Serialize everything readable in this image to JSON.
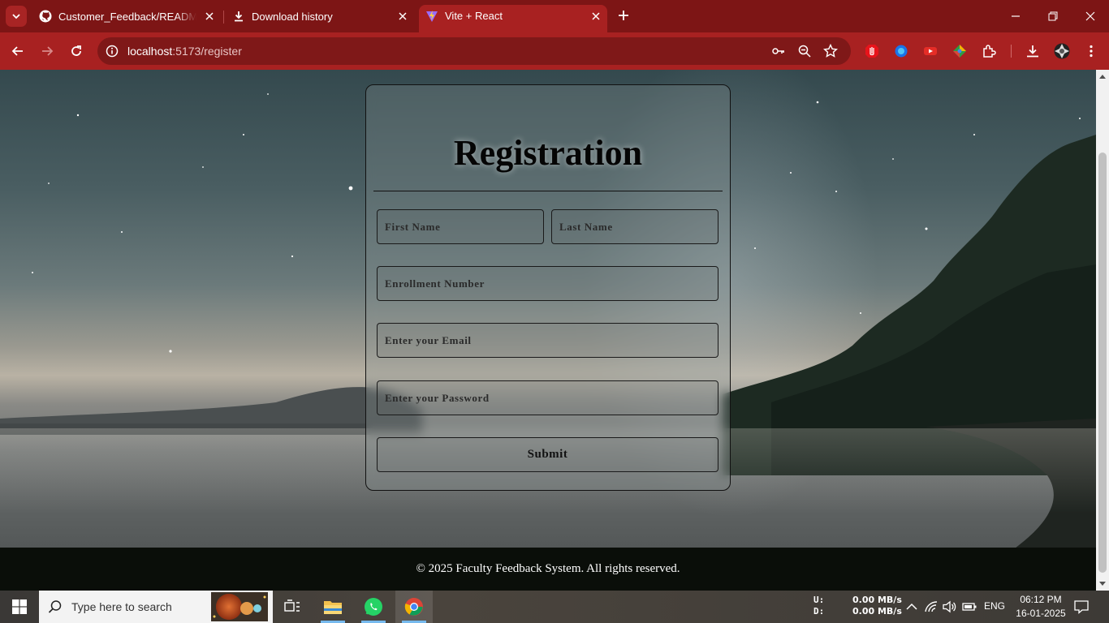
{
  "browser": {
    "tabs": [
      {
        "label": "Customer_Feedback/README.m",
        "icon": "github-icon"
      },
      {
        "label": "Download history",
        "icon": "download-icon"
      },
      {
        "label": "Vite + React",
        "icon": "vite-icon",
        "active": true
      }
    ],
    "url_host": "localhost",
    "url_path": ":5173/register",
    "theme_colors": {
      "tabstrip": "#7d1515",
      "toolbar": "#a82121",
      "omnibox": "#7f1818"
    }
  },
  "form": {
    "title": "Registration",
    "first_name_placeholder": "First Name",
    "last_name_placeholder": "Last Name",
    "enrollment_placeholder": "Enrollment Number",
    "email_placeholder": "Enter your Email",
    "password_placeholder": "Enter your Password",
    "submit_label": "Submit"
  },
  "footer": {
    "text": "© 2025 Faculty Feedback System. All rights reserved."
  },
  "taskbar": {
    "search_placeholder": "Type here to search",
    "net_up_label": "U:",
    "net_down_label": "D:",
    "net_up_value": "0.00 MB/s",
    "net_down_value": "0.00 MB/s",
    "language": "ENG",
    "time": "06:12 PM",
    "date": "16-01-2025"
  }
}
